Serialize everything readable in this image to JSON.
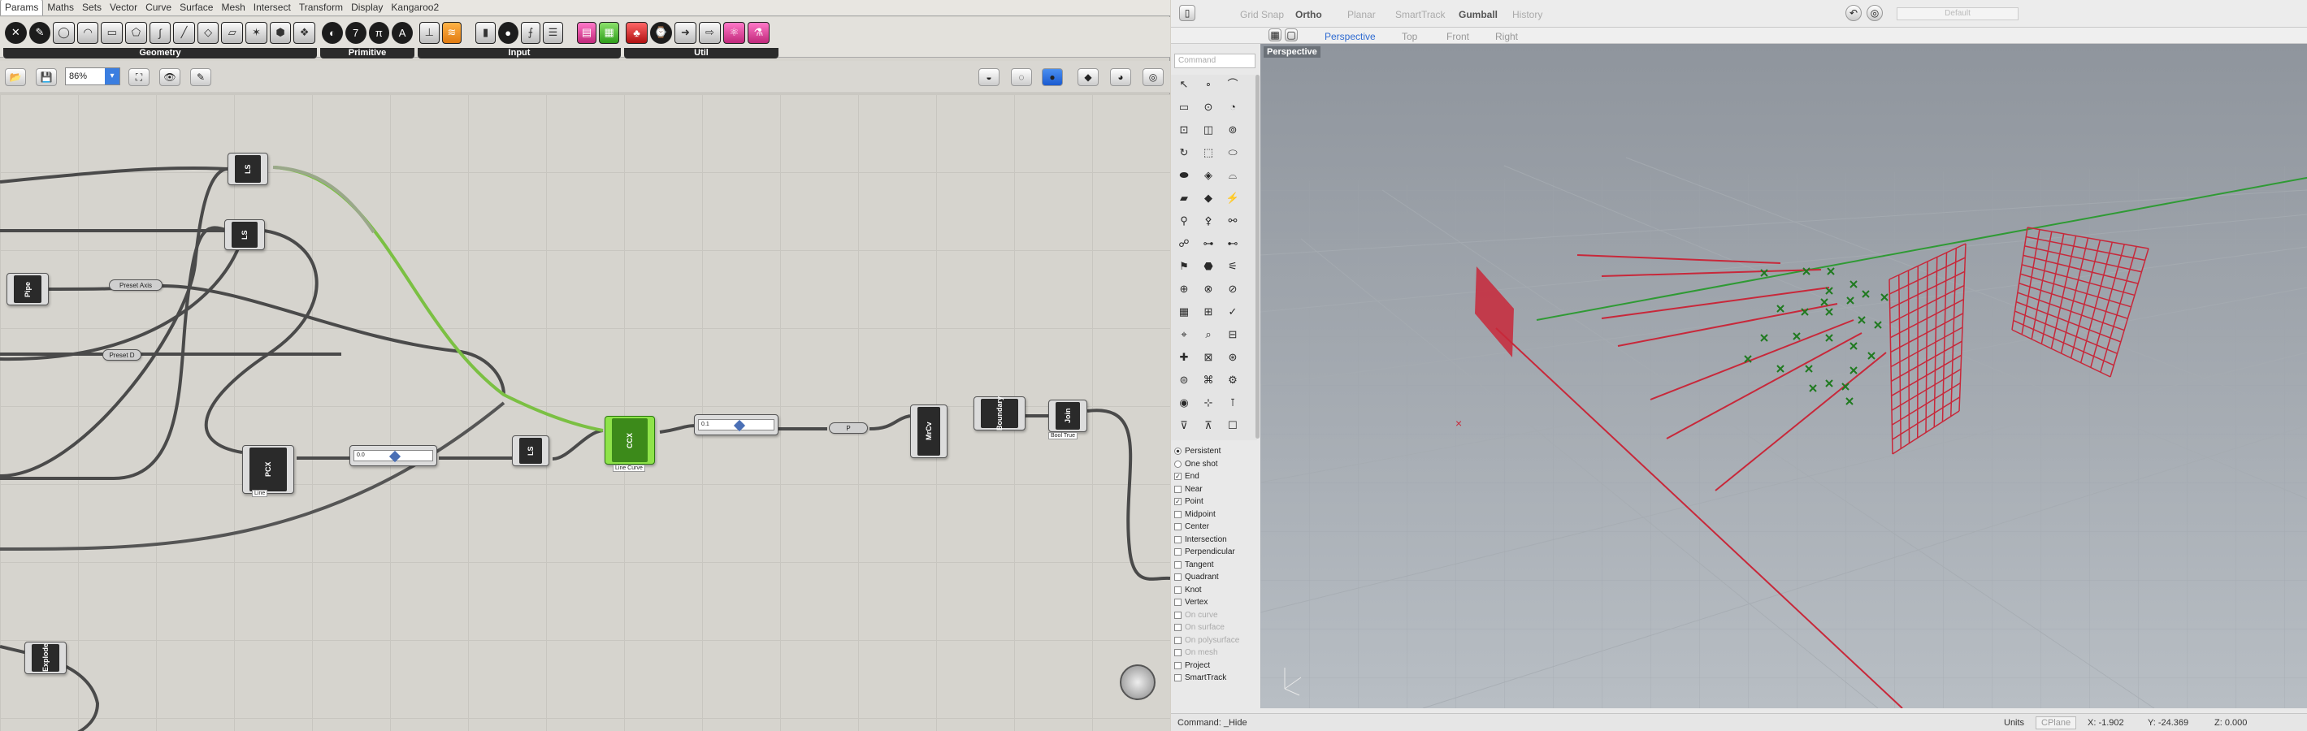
{
  "grasshopper": {
    "tabs": [
      "Params",
      "Maths",
      "Sets",
      "Vector",
      "Curve",
      "Surface",
      "Mesh",
      "Intersect",
      "Transform",
      "Display",
      "Kangaroo2"
    ],
    "active_tab": "Params",
    "ribbon_groups": [
      "Geometry",
      "Primitive",
      "Input",
      "Util"
    ],
    "zoom": "86%",
    "components": {
      "ls1": "LS",
      "ls2": "LS",
      "pipe": "Pipe",
      "pcx": "PCX",
      "ls3": "LS",
      "ccx": "CCX",
      "mcv": "MrCv",
      "boundary": "Boundary",
      "join": "Join",
      "explode": "Explode"
    },
    "params": {
      "preset_axis": "Preset Axis",
      "preset_d": "Preset D",
      "p1": "P"
    },
    "captions": {
      "pcx": "Line",
      "ccx": "Line Curve",
      "join": "Bool True"
    },
    "sliders": [
      "0.0",
      "0.1"
    ]
  },
  "rhino": {
    "top_toggles": [
      "Grid Snap",
      "Ortho",
      "Planar",
      "SmartTrack",
      "Gumball",
      "History"
    ],
    "active_toggles": [
      "Ortho",
      "Gumball"
    ],
    "layer": "Default",
    "view_tabs": [
      "Perspective",
      "Top",
      "Front",
      "Right"
    ],
    "active_view": "Perspective",
    "viewport_label": "Perspective",
    "command_placeholder": "Command",
    "osnap_modes": [
      {
        "label": "Persistent",
        "type": "radio",
        "on": true
      },
      {
        "label": "One shot",
        "type": "radio",
        "on": false
      },
      {
        "label": "End",
        "type": "check",
        "on": true
      },
      {
        "label": "Near",
        "type": "check",
        "on": false
      },
      {
        "label": "Point",
        "type": "check",
        "on": true
      },
      {
        "label": "Midpoint",
        "type": "check",
        "on": false
      },
      {
        "label": "Center",
        "type": "check",
        "on": false
      },
      {
        "label": "Intersection",
        "type": "check",
        "on": false
      },
      {
        "label": "Perpendicular",
        "type": "check",
        "on": false
      },
      {
        "label": "Tangent",
        "type": "check",
        "on": false
      },
      {
        "label": "Quadrant",
        "type": "check",
        "on": false
      },
      {
        "label": "Knot",
        "type": "check",
        "on": false
      },
      {
        "label": "Vertex",
        "type": "check",
        "on": false
      },
      {
        "label": "On curve",
        "type": "check",
        "on": false,
        "dim": true
      },
      {
        "label": "On surface",
        "type": "check",
        "on": false,
        "dim": true
      },
      {
        "label": "On polysurface",
        "type": "check",
        "on": false,
        "dim": true
      },
      {
        "label": "On mesh",
        "type": "check",
        "on": false,
        "dim": true
      },
      {
        "label": "Project",
        "type": "check",
        "on": false
      },
      {
        "label": "SmartTrack",
        "type": "check",
        "on": false
      }
    ],
    "status": {
      "command": "Command: _Hide",
      "units": "Units",
      "cplane": "CPlane",
      "x": "X: -1.902",
      "y": "Y: -24.369",
      "z": "Z: 0.000"
    },
    "colors": {
      "geometry": "#c8283a",
      "green_axis": "#2f9a34",
      "point": "#1f7a1f"
    }
  }
}
